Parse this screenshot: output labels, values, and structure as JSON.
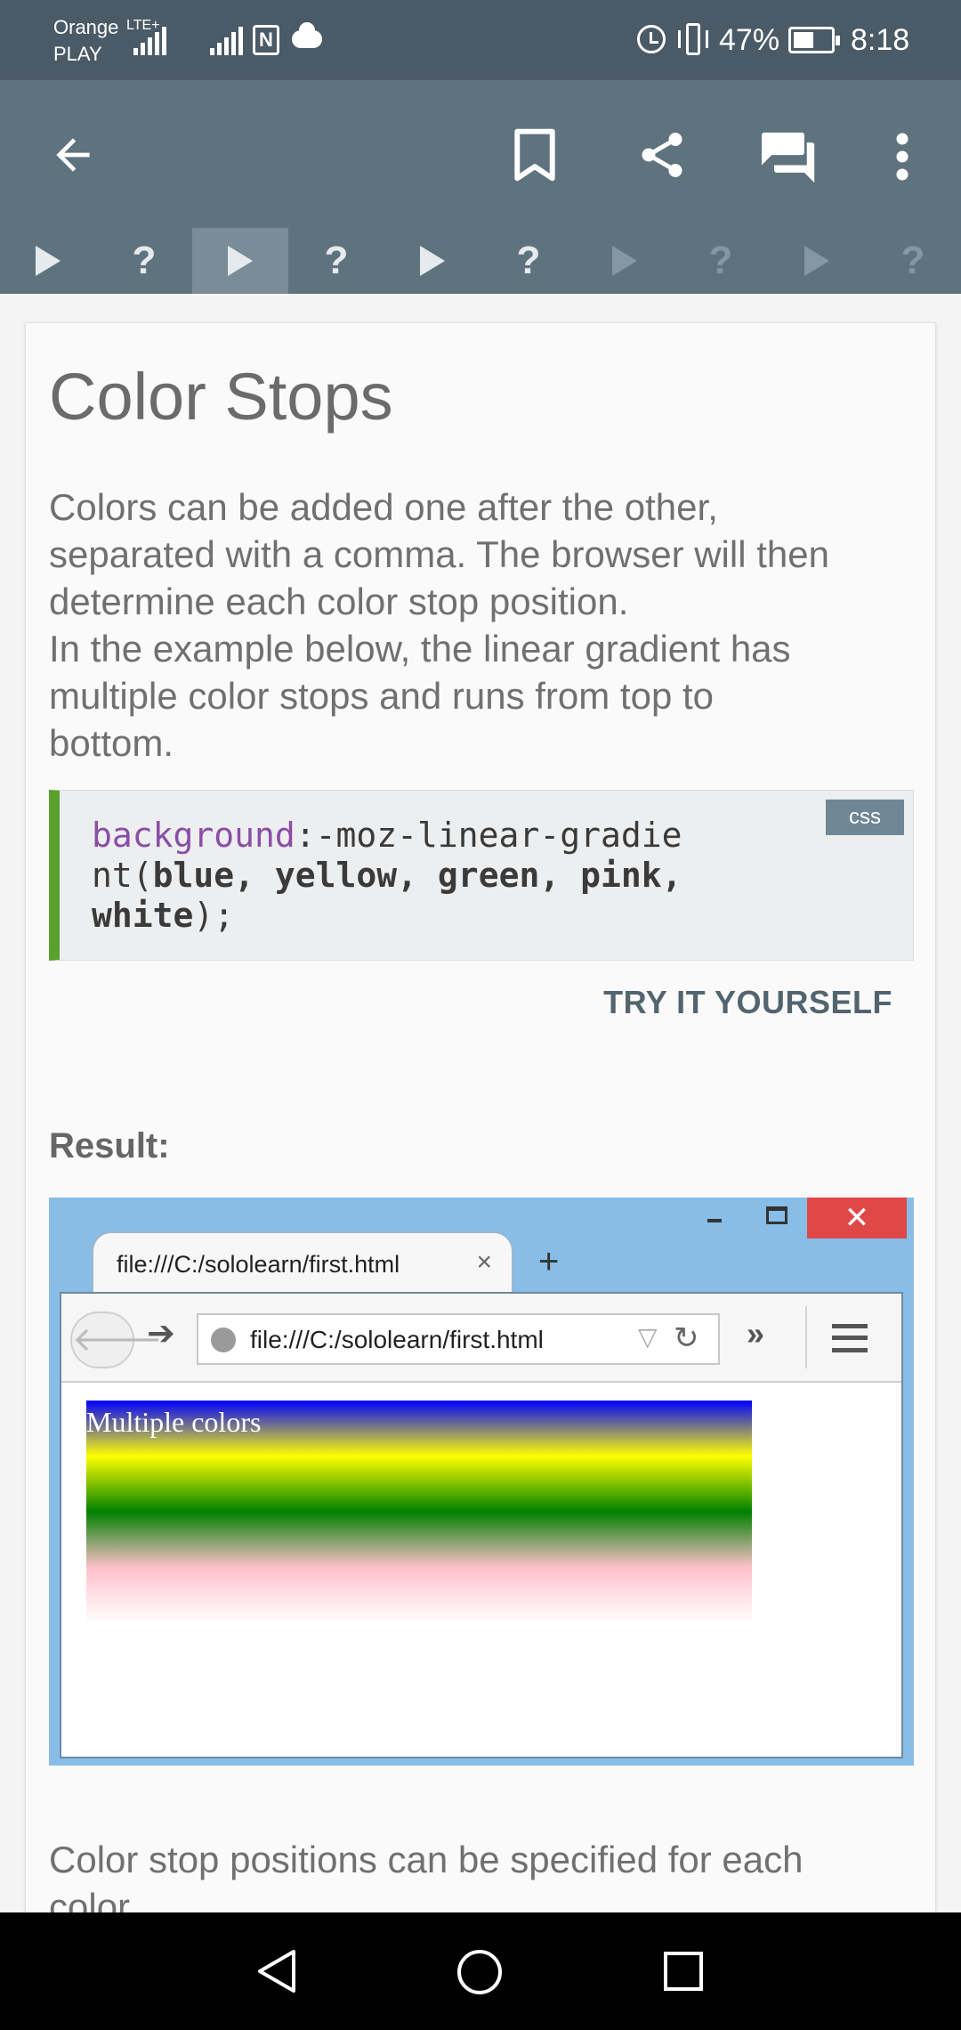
{
  "status_bar": {
    "carrier_line1": "Orange",
    "carrier_network": "LTE+",
    "carrier_line2": "PLAY",
    "battery_percent": "47%",
    "battery_level": 0.47,
    "time": "8:18"
  },
  "app_bar": {
    "icons": [
      "back-arrow-icon",
      "bookmark-icon",
      "share-icon",
      "chat-icon",
      "more-vert-icon"
    ]
  },
  "progress": {
    "steps": [
      {
        "kind": "lesson",
        "label": ""
      },
      {
        "kind": "quiz",
        "label": "?"
      },
      {
        "kind": "lesson",
        "label": ""
      },
      {
        "kind": "quiz",
        "label": "?"
      },
      {
        "kind": "lesson",
        "label": ""
      },
      {
        "kind": "quiz",
        "label": "?"
      },
      {
        "kind": "lesson",
        "label": ""
      },
      {
        "kind": "quiz",
        "label": "?"
      },
      {
        "kind": "lesson",
        "label": ""
      },
      {
        "kind": "quiz",
        "label": "?"
      }
    ],
    "active_index": 2,
    "completed_through": 5
  },
  "lesson": {
    "title": "Color Stops",
    "para1_line1": "Colors can be added one after the other,",
    "para1_line2": "separated with a comma. The browser will then",
    "para1_line3": "determine each color stop position.",
    "para1_line4": "In the example below, the linear gradient has",
    "para1_line5": "multiple color stops and runs from top to",
    "para1_line6": "bottom.",
    "para2_line1": "Color stop positions can be specified for each",
    "para2_line2": "color."
  },
  "code": {
    "language": "css",
    "prop": "background",
    "line1_rest": ":-moz-linear-gradie",
    "line2_prefix": "nt(",
    "line2_vals": "blue, yellow, green, pink,",
    "line3_val": "white",
    "line3_suffix": ");"
  },
  "try_it_label": "TRY IT YOURSELF",
  "result_label": "Result:",
  "browser": {
    "tab_title": "file:///C:/sololearn/first.html",
    "tab_close": "×",
    "new_tab": "+",
    "url": "file:///C:/sololearn/first.html",
    "close_glyph": "✕",
    "back_glyph": "🡐",
    "forward_glyph": "➔",
    "dropdown_glyph": "▽",
    "reload_glyph": "↻",
    "overflow_glyph": "»",
    "demo_text": "Multiple colors",
    "gradient_colors": [
      "#0000ff",
      "#ffff00",
      "#008000",
      "#ffc0cb",
      "#ffffff"
    ]
  },
  "nav_bar": {
    "icons": [
      "nav-back-icon",
      "nav-home-icon",
      "nav-recents-icon"
    ]
  },
  "colors": {
    "status_bar": "#4a5a66",
    "app_bar": "#5f737f",
    "accent_green": "#5aa02c",
    "link": "#52656f"
  }
}
